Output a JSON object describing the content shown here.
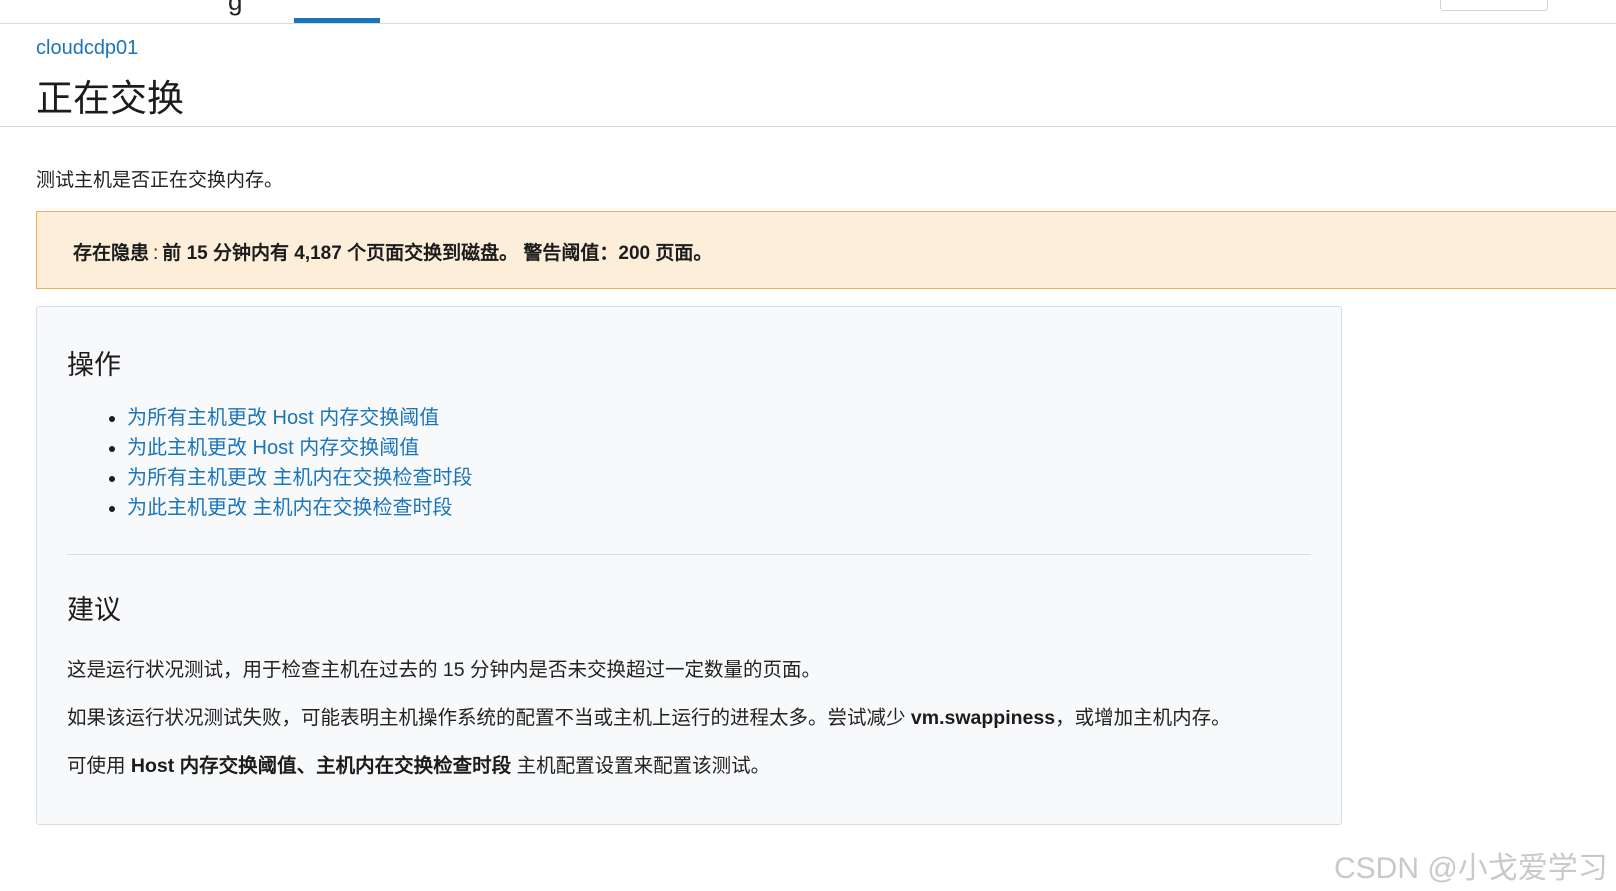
{
  "topnav": {
    "tab_fragment": "g"
  },
  "header": {
    "breadcrumb": "cloudcdp01",
    "title": "正在交换"
  },
  "description": "测试主机是否正在交换内存。",
  "alert": {
    "label": "存在隐患",
    "separator": ":",
    "message": "前 15 分钟内有 4,187 个页面交换到磁盘。 警告阈值：200 页面。"
  },
  "actions": {
    "title": "操作",
    "links": [
      "为所有主机更改 Host 内存交换阈值",
      "为此主机更改 Host 内存交换阈值",
      "为所有主机更改 主机内在交换检查时段",
      "为此主机更改 主机内在交换检查时段"
    ]
  },
  "advice": {
    "title": "建议",
    "p1": "这是运行状况测试，用于检查主机在过去的 15 分钟内是否未交换超过一定数量的页面。",
    "p2_prefix": "如果该运行状况测试失败，可能表明主机操作系统的配置不当或主机上运行的进程太多。尝试减少 ",
    "p2_bold": "vm.swappiness",
    "p2_suffix": "，或增加主机内存。",
    "p3_prefix": "可使用 ",
    "p3_bold": "Host 内存交换阈值、主机内在交换检查时段",
    "p3_suffix": " 主机配置设置来配置该测试。"
  },
  "watermark": "CSDN @小戈爱学习",
  "colors": {
    "link": "#1b75bb",
    "alert_bg": "#fdeed9",
    "alert_border": "#e9b25a",
    "panel_bg": "#f8f9fb"
  }
}
